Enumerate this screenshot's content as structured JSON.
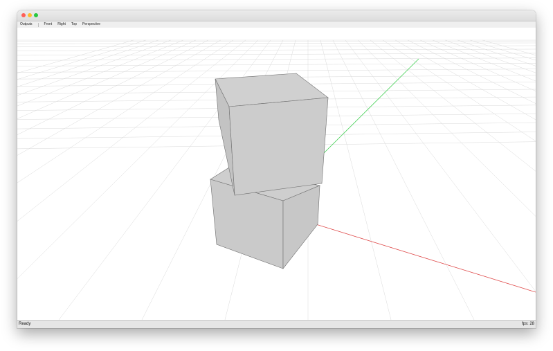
{
  "toolbar": {
    "items": [
      "Outputs",
      "Front",
      "Right",
      "Top",
      "Perspective"
    ]
  },
  "status": {
    "left": "Ready",
    "right": "fps: 28"
  },
  "colors": {
    "close": "#ff5f57",
    "minimize": "#febc2e",
    "maximize": "#28c840",
    "grid": "#d9d9d9",
    "axis_x": "#e05050",
    "axis_y": "#3ecf50",
    "cube_face": "#cccccc",
    "cube_edge": "#6f6f6f"
  },
  "icons": [
    "close-button",
    "minimize-button",
    "maximize-button"
  ]
}
